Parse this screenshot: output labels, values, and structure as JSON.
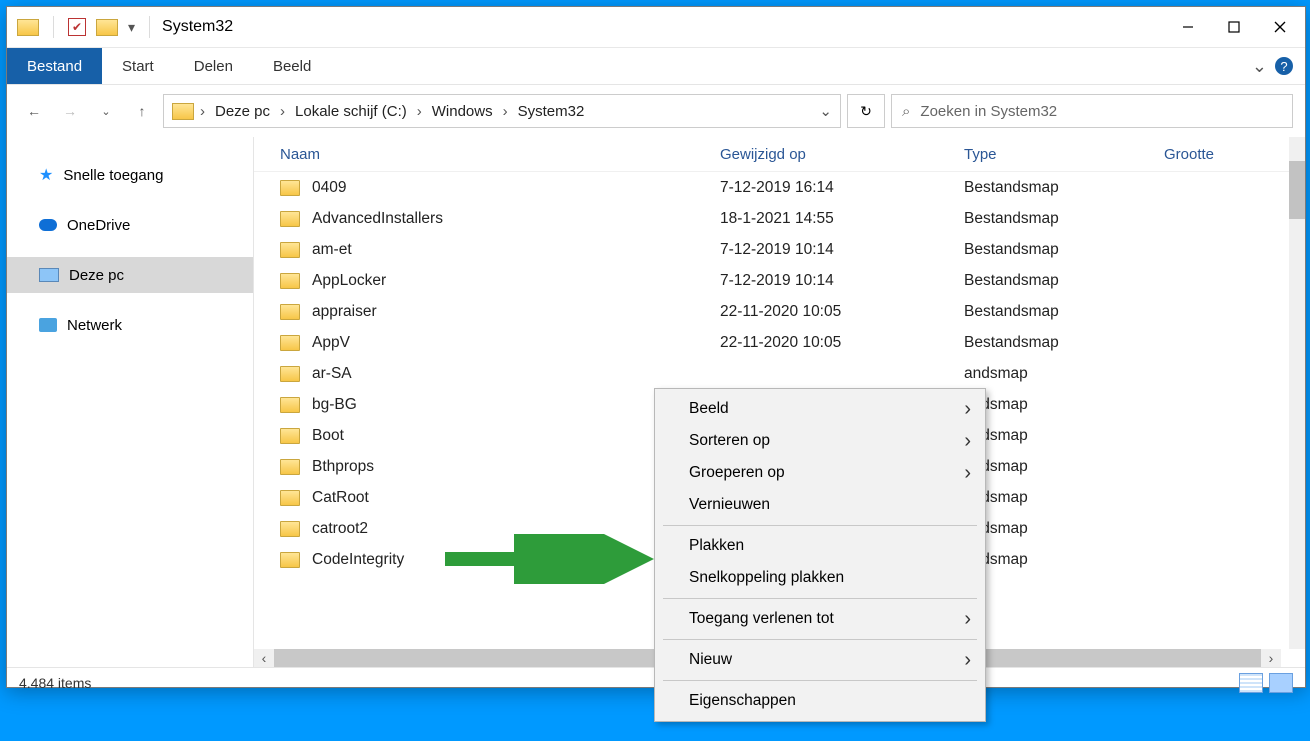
{
  "window": {
    "title": "System32"
  },
  "ribbon": {
    "tabs": {
      "file": "Bestand",
      "start": "Start",
      "share": "Delen",
      "view": "Beeld"
    }
  },
  "breadcrumbs": {
    "b0": "Deze pc",
    "b1": "Lokale schijf (C:)",
    "b2": "Windows",
    "b3": "System32"
  },
  "search": {
    "placeholder": "Zoeken in System32"
  },
  "tree": {
    "quick": "Snelle toegang",
    "onedrive": "OneDrive",
    "thispc": "Deze pc",
    "network": "Netwerk"
  },
  "columns": {
    "name": "Naam",
    "modified": "Gewijzigd op",
    "type": "Type",
    "size": "Grootte"
  },
  "rows": [
    {
      "name": "0409",
      "date": "7-12-2019 16:14",
      "type": "Bestandsmap"
    },
    {
      "name": "AdvancedInstallers",
      "date": "18-1-2021 14:55",
      "type": "Bestandsmap"
    },
    {
      "name": "am-et",
      "date": "7-12-2019 10:14",
      "type": "Bestandsmap"
    },
    {
      "name": "AppLocker",
      "date": "7-12-2019 10:14",
      "type": "Bestandsmap"
    },
    {
      "name": "appraiser",
      "date": "22-11-2020 10:05",
      "type": "Bestandsmap"
    },
    {
      "name": "AppV",
      "date": "22-11-2020 10:05",
      "type": "Bestandsmap"
    },
    {
      "name": "ar-SA",
      "date": "",
      "type": "andsmap"
    },
    {
      "name": "bg-BG",
      "date": "",
      "type": "andsmap"
    },
    {
      "name": "Boot",
      "date": "",
      "type": "andsmap"
    },
    {
      "name": "Bthprops",
      "date": "",
      "type": "andsmap"
    },
    {
      "name": "CatRoot",
      "date": "",
      "type": "andsmap"
    },
    {
      "name": "catroot2",
      "date": "",
      "type": "andsmap"
    },
    {
      "name": "CodeIntegrity",
      "date": "",
      "type": "andsmap"
    }
  ],
  "context": {
    "view": "Beeld",
    "sort": "Sorteren op",
    "group": "Groeperen op",
    "refresh": "Vernieuwen",
    "paste": "Plakken",
    "paste_shortcut": "Snelkoppeling plakken",
    "grant_access": "Toegang verlenen tot",
    "new": "Nieuw",
    "properties": "Eigenschappen"
  },
  "status": {
    "items": "4.484 items"
  }
}
